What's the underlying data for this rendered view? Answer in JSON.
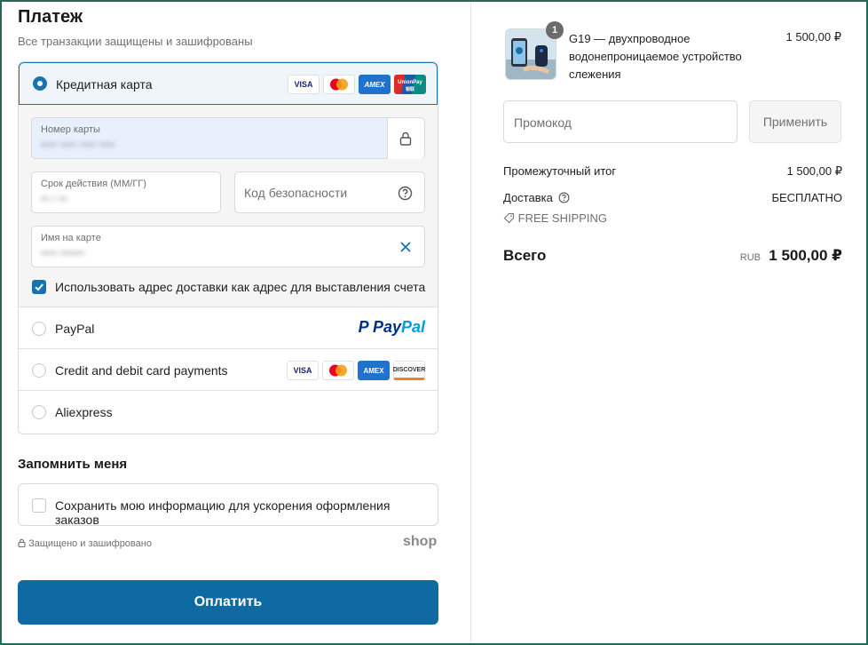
{
  "payment": {
    "title": "Платеж",
    "subtitle": "Все транзакции защищены и зашифрованы",
    "credit_card": {
      "label": "Кредитная карта",
      "brands": [
        "VISA",
        "Mastercard",
        "AMEX",
        "UnionPay"
      ],
      "card_number_label": "Номер карты",
      "card_number_value": "•••• •••• •••• ••••",
      "expiry_label": "Срок действия (ММ/ГГ)",
      "expiry_value": "•• / ••",
      "security_code_placeholder": "Код безопасности",
      "name_label": "Имя на карте",
      "name_value": "•••• ••••••",
      "billing_checkbox_label": "Использовать адрес доставки как адрес для выставления счета",
      "billing_checked": true
    },
    "paypal": {
      "label": "PayPal",
      "logo_text_1": "Pay",
      "logo_text_2": "Pal"
    },
    "cards_option": {
      "label": "Credit and debit card payments",
      "brands": [
        "VISA",
        "Mastercard",
        "AMEX",
        "DISCOVER"
      ]
    },
    "aliexpress": {
      "label": "Aliexpress"
    }
  },
  "remember": {
    "title": "Запомнить меня",
    "checkbox_label": "Сохранить мою информацию для ускорения оформления заказов",
    "checked": false
  },
  "footer": {
    "secure_text": "Защищено и зашифровано",
    "shop_logo": "shop",
    "pay_button": "Оплатить"
  },
  "order": {
    "product": {
      "quantity": "1",
      "name": "G19 — двухпроводное водонепроницаемое устройство слежения",
      "price": "1 500,00 ₽"
    },
    "promo_placeholder": "Промокод",
    "apply_button": "Применить",
    "subtotal_label": "Промежуточный итог",
    "subtotal_value": "1 500,00 ₽",
    "shipping_label": "Доставка",
    "shipping_value": "БЕСПЛАТНО",
    "shipping_tag": "FREE SHIPPING",
    "total_label": "Всего",
    "total_currency": "RUB",
    "total_value": "1 500,00 ₽"
  },
  "colors": {
    "accent": "#1773b0",
    "pay_button": "#0f6aa4",
    "selected_bg": "#f0f5fa"
  }
}
